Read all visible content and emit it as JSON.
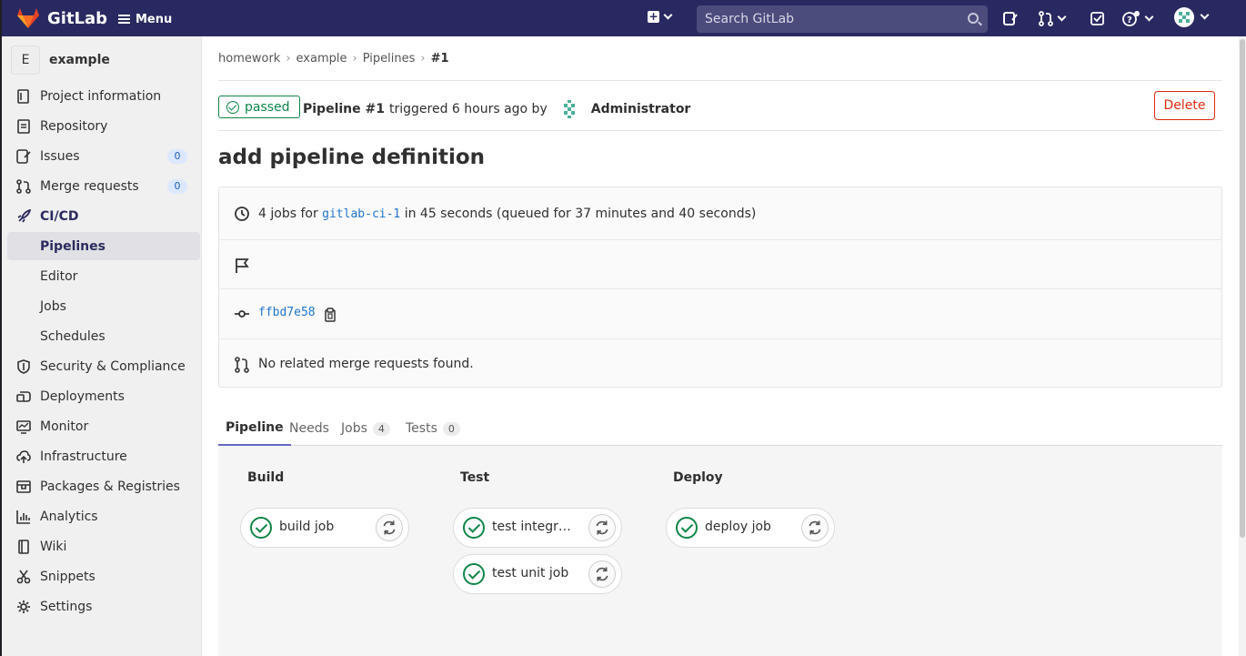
{
  "topbar": {
    "brand": "GitLab",
    "menu_label": "Menu",
    "search_placeholder": "Search GitLab",
    "colors": {
      "bar": "#292961"
    }
  },
  "sidebar": {
    "project_initial": "E",
    "project_name": "example",
    "items": [
      {
        "label": "Project information",
        "icon": "info-icon"
      },
      {
        "label": "Repository",
        "icon": "doc-icon"
      },
      {
        "label": "Issues",
        "icon": "issues-icon",
        "count": "0"
      },
      {
        "label": "Merge requests",
        "icon": "merge-request-icon",
        "count": "0"
      },
      {
        "label": "CI/CD",
        "icon": "rocket-icon"
      },
      {
        "label": "Pipelines"
      },
      {
        "label": "Editor"
      },
      {
        "label": "Jobs"
      },
      {
        "label": "Schedules"
      },
      {
        "label": "Security & Compliance",
        "icon": "shield-icon"
      },
      {
        "label": "Deployments",
        "icon": "deployments-icon"
      },
      {
        "label": "Monitor",
        "icon": "monitor-icon"
      },
      {
        "label": "Infrastructure",
        "icon": "cloud-icon"
      },
      {
        "label": "Packages & Registries",
        "icon": "package-icon"
      },
      {
        "label": "Analytics",
        "icon": "chart-icon"
      },
      {
        "label": "Wiki",
        "icon": "book-icon"
      },
      {
        "label": "Snippets",
        "icon": "scissors-icon"
      },
      {
        "label": "Settings",
        "icon": "gear-icon"
      }
    ]
  },
  "breadcrumb": {
    "items": [
      "homework",
      "example",
      "Pipelines",
      "#1"
    ]
  },
  "pipeline": {
    "status": "passed",
    "name": "Pipeline #1",
    "triggered": "triggered 6 hours ago by",
    "author": "Administrator",
    "delete_label": "Delete",
    "title": "add pipeline definition",
    "jobs_prefix": "4 jobs for",
    "branch": "gitlab-ci-1",
    "duration": "in 45 seconds (queued for 37 minutes and 40 seconds)",
    "commit": "ffbd7e58",
    "merge_requests": "No related merge requests found."
  },
  "tabs": [
    {
      "label": "Pipeline"
    },
    {
      "label": "Needs"
    },
    {
      "label": "Jobs",
      "count": "4"
    },
    {
      "label": "Tests",
      "count": "0"
    }
  ],
  "stages": [
    {
      "name": "Build",
      "jobs": [
        "build job"
      ]
    },
    {
      "name": "Test",
      "jobs": [
        "test integra...",
        "test unit job"
      ]
    },
    {
      "name": "Deploy",
      "jobs": [
        "deploy job"
      ]
    }
  ],
  "colors": {
    "success": "#108548",
    "danger": "#dd2b0e",
    "link": "#1f75cb"
  }
}
